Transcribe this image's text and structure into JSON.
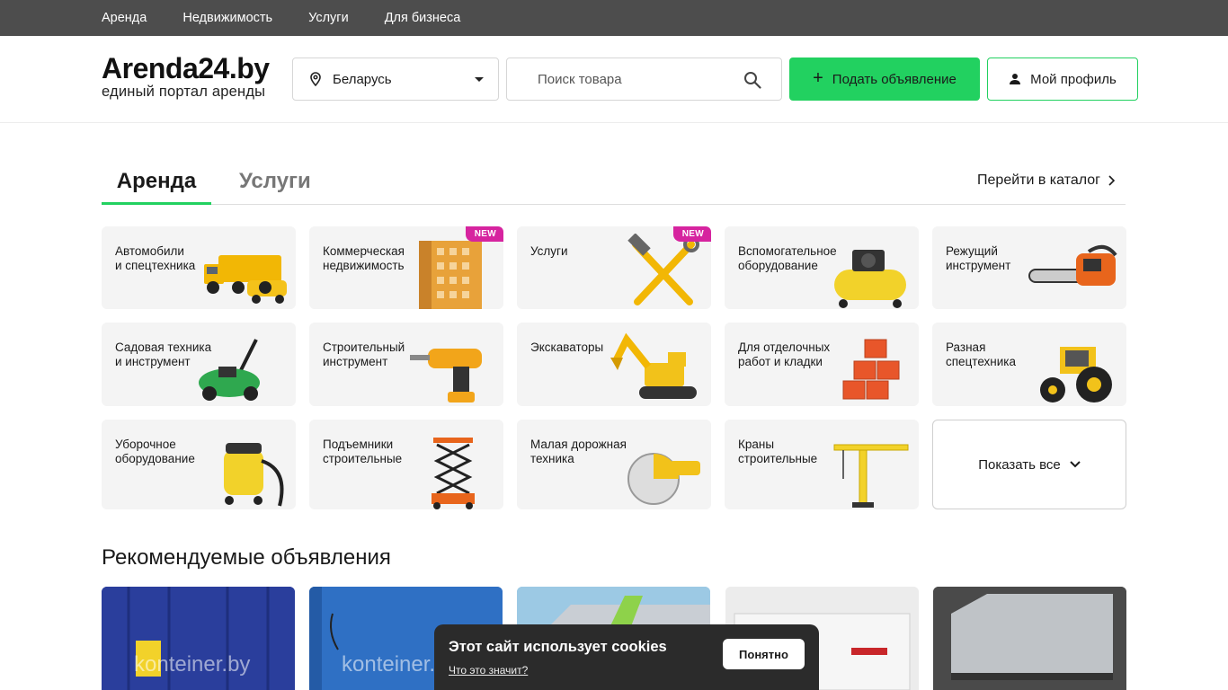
{
  "topnav": {
    "items": [
      "Аренда",
      "Недвижимость",
      "Услуги",
      "Для бизнеса"
    ]
  },
  "header": {
    "logo_title": "Arenda24.by",
    "logo_subtitle": "единый портал аренды",
    "region": "Беларусь",
    "search_placeholder": "Поиск товара",
    "add_button": "Подать объявление",
    "profile_button": "Мой профиль"
  },
  "tabs": {
    "active": "Аренда",
    "inactive": "Услуги",
    "catalog_link": "Перейти в каталог"
  },
  "categories": [
    {
      "label": "Автомобили\nи спецтехника",
      "badge": ""
    },
    {
      "label": "Коммерческая\nнедвижимость",
      "badge": "NEW"
    },
    {
      "label": "Услуги",
      "badge": "NEW"
    },
    {
      "label": "Вспомогательное\nоборудование",
      "badge": ""
    },
    {
      "label": "Режущий\nинструмент",
      "badge": ""
    },
    {
      "label": "Садовая техника\nи инструмент",
      "badge": ""
    },
    {
      "label": "Строительный\nинструмент",
      "badge": ""
    },
    {
      "label": "Экскаваторы",
      "badge": ""
    },
    {
      "label": "Для отделочных\nработ и кладки",
      "badge": ""
    },
    {
      "label": "Разная\nспецтехника",
      "badge": ""
    },
    {
      "label": "Уборочное\nоборудование",
      "badge": ""
    },
    {
      "label": "Подъемники\nстроительные",
      "badge": ""
    },
    {
      "label": "Малая дорожная\nтехника",
      "badge": ""
    },
    {
      "label": "Краны\nстроительные",
      "badge": ""
    }
  ],
  "show_all": "Показать все",
  "recommended": {
    "title": "Рекомендуемые объявления",
    "watermark": "konteiner.by"
  },
  "cookie": {
    "title": "Этот сайт использует cookies",
    "link": "Что это значит?",
    "button": "Понятно"
  },
  "colors": {
    "accent": "#22d160",
    "topbar": "#4d4d4d",
    "badge": "#d6249f"
  }
}
